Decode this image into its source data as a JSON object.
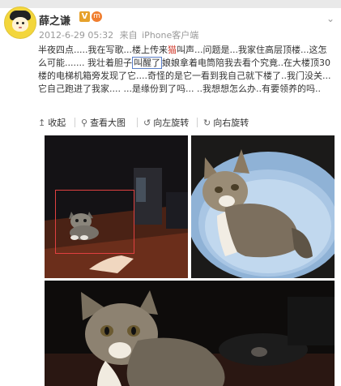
{
  "post": {
    "user": {
      "name": "薛之谦",
      "verified_badge": "V",
      "member_badge": "m"
    },
    "meta": {
      "time": "2012-6-29 05:32",
      "source_prefix": "来自",
      "source": "iPhone客户端"
    },
    "text": {
      "part1": "半夜四点.....我在写歌...楼上传来",
      "highlight": "猫",
      "part2": "叫声...问题是...我家住高层顶楼...这怎么可能....... 我壮着胆子",
      "boxed": "叫醒了",
      "part3": "娘娘拿着电筒陪我去看个究竟..在大楼顶30楼的电梯机箱旁发现了它....奇怪的是它一看到我自己就下楼了..我门没关...它自己跑进了我家....   ...是缘份到了吗... ..我想想怎么办..有要领养的吗.."
    },
    "toolbar": {
      "collapse": "收起",
      "view_large": "查看大图",
      "rotate_left": "向左旋转",
      "rotate_right": "向右旋转"
    },
    "photos": [
      {
        "icon": "kitten-photo-dark-room"
      },
      {
        "icon": "kitten-in-blue-bowl"
      },
      {
        "icon": "kitten-closeup"
      }
    ]
  },
  "colors": {
    "highlight": "#d23f31",
    "box_outline": "#5a7ec7",
    "annotation_box": "#e04040",
    "verified": "#e6a12b"
  }
}
